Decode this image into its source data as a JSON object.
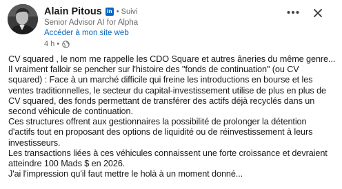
{
  "author": {
    "name": "Alain Pitous",
    "badge": "in",
    "separator": "•",
    "follow_status": "Suivi",
    "headline": "Senior Advisor AI for Alpha",
    "site_link": "Accéder à mon site web",
    "time": "4 h •",
    "visibility_icon": "globe-icon"
  },
  "actions": {
    "more_icon": "ellipsis-icon",
    "close_icon": "close-icon"
  },
  "post": {
    "lines": [
      "CV squared , le nom me rappelle les CDO Square et autres âneries du même genre...",
      "Il vraiment falloir se pencher sur l'histoire des \"fonds de continuation\" (ou CV",
      "squared) : Face à un marché difficile qui freine les introductions en bourse et les",
      "ventes traditionnelles, le secteur du capital-investissement utilise de plus en plus de",
      "CV squared, des fonds permettant de transférer des actifs déjà recyclés dans un",
      "second véhicule de continuation.",
      "Ces structures offrent aux gestionnaires la possibilité de prolonger la détention",
      "d'actifs tout en proposant des options de liquidité ou de réinvestissement à leurs",
      "investisseurs.",
      "Les transactions liées à ces véhicules connaissent une forte croissance et devraient",
      "atteindre 100 Mads $ en 2026.",
      "J'ai l'impression qu'il faut mettre le holà à un moment donné..."
    ]
  },
  "colors": {
    "brand_blue": "#0a66c2",
    "text_primary": "#1a1a1a",
    "text_secondary": "#666666"
  }
}
